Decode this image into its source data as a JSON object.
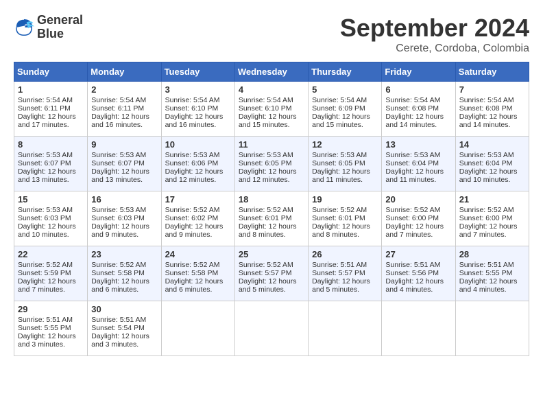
{
  "logo": {
    "line1": "General",
    "line2": "Blue"
  },
  "title": "September 2024",
  "location": "Cerete, Cordoba, Colombia",
  "headers": [
    "Sunday",
    "Monday",
    "Tuesday",
    "Wednesday",
    "Thursday",
    "Friday",
    "Saturday"
  ],
  "weeks": [
    [
      {
        "day": "1",
        "sunrise": "5:54 AM",
        "sunset": "6:11 PM",
        "daylight": "12 hours and 17 minutes."
      },
      {
        "day": "2",
        "sunrise": "5:54 AM",
        "sunset": "6:11 PM",
        "daylight": "12 hours and 16 minutes."
      },
      {
        "day": "3",
        "sunrise": "5:54 AM",
        "sunset": "6:10 PM",
        "daylight": "12 hours and 16 minutes."
      },
      {
        "day": "4",
        "sunrise": "5:54 AM",
        "sunset": "6:10 PM",
        "daylight": "12 hours and 15 minutes."
      },
      {
        "day": "5",
        "sunrise": "5:54 AM",
        "sunset": "6:09 PM",
        "daylight": "12 hours and 15 minutes."
      },
      {
        "day": "6",
        "sunrise": "5:54 AM",
        "sunset": "6:08 PM",
        "daylight": "12 hours and 14 minutes."
      },
      {
        "day": "7",
        "sunrise": "5:54 AM",
        "sunset": "6:08 PM",
        "daylight": "12 hours and 14 minutes."
      }
    ],
    [
      {
        "day": "8",
        "sunrise": "5:53 AM",
        "sunset": "6:07 PM",
        "daylight": "12 hours and 13 minutes."
      },
      {
        "day": "9",
        "sunrise": "5:53 AM",
        "sunset": "6:07 PM",
        "daylight": "12 hours and 13 minutes."
      },
      {
        "day": "10",
        "sunrise": "5:53 AM",
        "sunset": "6:06 PM",
        "daylight": "12 hours and 12 minutes."
      },
      {
        "day": "11",
        "sunrise": "5:53 AM",
        "sunset": "6:05 PM",
        "daylight": "12 hours and 12 minutes."
      },
      {
        "day": "12",
        "sunrise": "5:53 AM",
        "sunset": "6:05 PM",
        "daylight": "12 hours and 11 minutes."
      },
      {
        "day": "13",
        "sunrise": "5:53 AM",
        "sunset": "6:04 PM",
        "daylight": "12 hours and 11 minutes."
      },
      {
        "day": "14",
        "sunrise": "5:53 AM",
        "sunset": "6:04 PM",
        "daylight": "12 hours and 10 minutes."
      }
    ],
    [
      {
        "day": "15",
        "sunrise": "5:53 AM",
        "sunset": "6:03 PM",
        "daylight": "12 hours and 10 minutes."
      },
      {
        "day": "16",
        "sunrise": "5:53 AM",
        "sunset": "6:03 PM",
        "daylight": "12 hours and 9 minutes."
      },
      {
        "day": "17",
        "sunrise": "5:52 AM",
        "sunset": "6:02 PM",
        "daylight": "12 hours and 9 minutes."
      },
      {
        "day": "18",
        "sunrise": "5:52 AM",
        "sunset": "6:01 PM",
        "daylight": "12 hours and 8 minutes."
      },
      {
        "day": "19",
        "sunrise": "5:52 AM",
        "sunset": "6:01 PM",
        "daylight": "12 hours and 8 minutes."
      },
      {
        "day": "20",
        "sunrise": "5:52 AM",
        "sunset": "6:00 PM",
        "daylight": "12 hours and 7 minutes."
      },
      {
        "day": "21",
        "sunrise": "5:52 AM",
        "sunset": "6:00 PM",
        "daylight": "12 hours and 7 minutes."
      }
    ],
    [
      {
        "day": "22",
        "sunrise": "5:52 AM",
        "sunset": "5:59 PM",
        "daylight": "12 hours and 7 minutes."
      },
      {
        "day": "23",
        "sunrise": "5:52 AM",
        "sunset": "5:58 PM",
        "daylight": "12 hours and 6 minutes."
      },
      {
        "day": "24",
        "sunrise": "5:52 AM",
        "sunset": "5:58 PM",
        "daylight": "12 hours and 6 minutes."
      },
      {
        "day": "25",
        "sunrise": "5:52 AM",
        "sunset": "5:57 PM",
        "daylight": "12 hours and 5 minutes."
      },
      {
        "day": "26",
        "sunrise": "5:51 AM",
        "sunset": "5:57 PM",
        "daylight": "12 hours and 5 minutes."
      },
      {
        "day": "27",
        "sunrise": "5:51 AM",
        "sunset": "5:56 PM",
        "daylight": "12 hours and 4 minutes."
      },
      {
        "day": "28",
        "sunrise": "5:51 AM",
        "sunset": "5:55 PM",
        "daylight": "12 hours and 4 minutes."
      }
    ],
    [
      {
        "day": "29",
        "sunrise": "5:51 AM",
        "sunset": "5:55 PM",
        "daylight": "12 hours and 3 minutes."
      },
      {
        "day": "30",
        "sunrise": "5:51 AM",
        "sunset": "5:54 PM",
        "daylight": "12 hours and 3 minutes."
      },
      null,
      null,
      null,
      null,
      null
    ]
  ]
}
